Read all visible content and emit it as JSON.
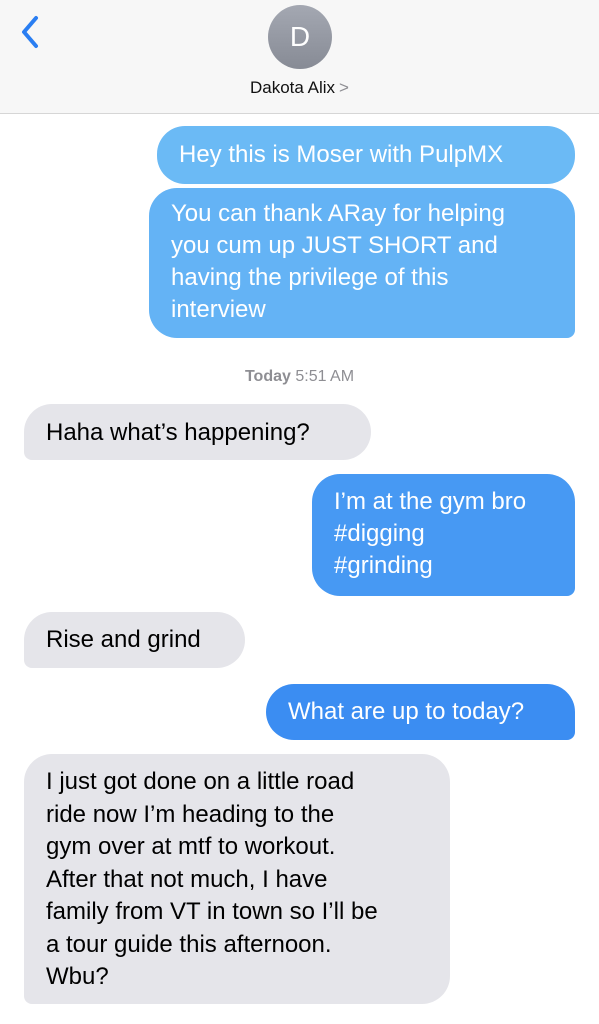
{
  "header": {
    "back_icon": "chevron-left-icon",
    "avatar_initial": "D",
    "contact_name": "Dakota Alix",
    "contact_chevron": ">"
  },
  "timestamp": {
    "day": "Today",
    "time": "5:51 AM"
  },
  "colors": {
    "outgoing_top": "#6fbcf5",
    "outgoing_bottom": "#3b8df2",
    "incoming": "#e5e5ea",
    "accent": "#2a7ef2"
  },
  "messages": [
    {
      "direction": "outgoing",
      "text": "Hey this is Moser with PulpMX"
    },
    {
      "direction": "outgoing",
      "lines": [
        "You can thank ARay for helping",
        "you cum up JUST SHORT and",
        "having the privilege of this",
        "interview"
      ]
    },
    {
      "direction": "incoming",
      "text": "Haha what’s happening?"
    },
    {
      "direction": "outgoing",
      "lines": [
        "I’m at the gym bro",
        "#digging",
        "#grinding"
      ]
    },
    {
      "direction": "incoming",
      "text": "Rise and grind"
    },
    {
      "direction": "outgoing",
      "text": "What are up to today?"
    },
    {
      "direction": "incoming",
      "lines": [
        "I just got done on a little road",
        "ride now I’m heading to the",
        "gym over at mtf to workout.",
        "After that not much, I have",
        "family from VT in town so I’ll be",
        "a tour guide this afternoon.",
        "Wbu?"
      ]
    }
  ]
}
